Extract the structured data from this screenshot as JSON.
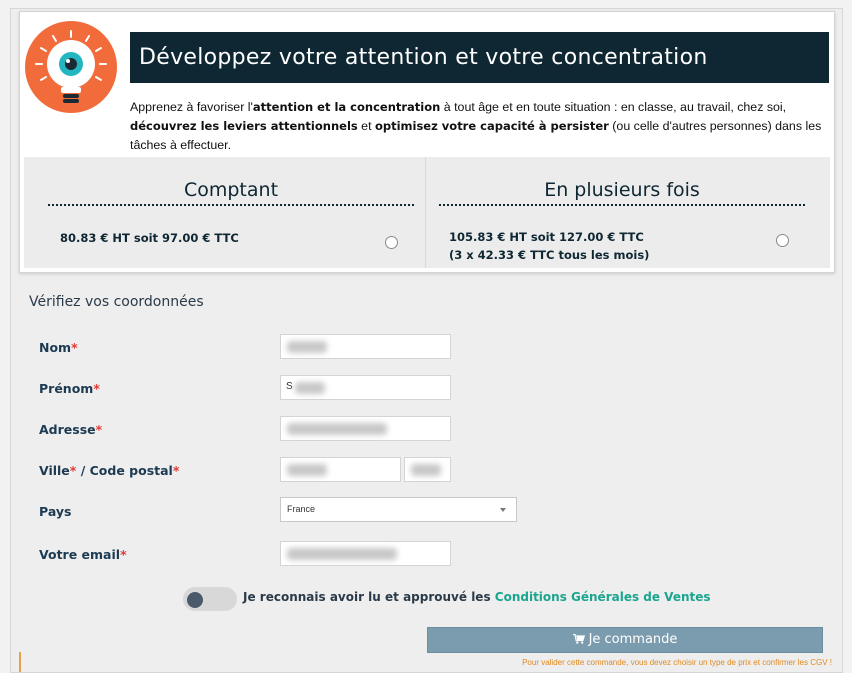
{
  "header": {
    "title": "Développez votre attention et votre concentration",
    "desc_parts": [
      "Apprenez à favoriser l'",
      "attention et la concentration",
      " à tout âge et en toute situation : en classe, au travail, chez soi, ",
      "découvrez les leviers attentionnels",
      " et ",
      "optimisez votre capacité à persister",
      " (ou celle d'autres personnes) dans les tâches à effectuer."
    ]
  },
  "pricing": {
    "cash": {
      "title": "Comptant",
      "line1": "80.83 € HT soit 97.00 € TTC"
    },
    "installments": {
      "title": "En plusieurs fois",
      "line1": "105.83 € HT soit 127.00 € TTC",
      "line2": "(3 x 42.33 € TTC tous les mois)"
    }
  },
  "form": {
    "title": "Vérifiez vos coordonnées",
    "labels": {
      "nom": "Nom",
      "prenom": "Prénom",
      "adresse": "Adresse",
      "ville": "Ville",
      "sep": " / ",
      "code_postal": "Code postal",
      "pays": "Pays",
      "email": "Votre email"
    },
    "required_mark": "*",
    "prenom_prefix": "S",
    "country_value": "France"
  },
  "cgv": {
    "text": "Je reconnais avoir lu et approuvé les ",
    "link": "Conditions Générales de Ventes"
  },
  "order": {
    "button_label": "Je commande",
    "warning": "Pour valider cette commande, vous devez choisir un type de prix et confirmer les CGV !"
  },
  "colors": {
    "title_bg": "#0f2733",
    "accent_link": "#1aa58f",
    "button": "#7b9cae",
    "warning": "#e08a21",
    "required": "#e53935"
  },
  "icons": {
    "logo": "eye-lightbulb-icon",
    "cart": "cart-icon",
    "select_caret": "chevron-down-icon"
  }
}
